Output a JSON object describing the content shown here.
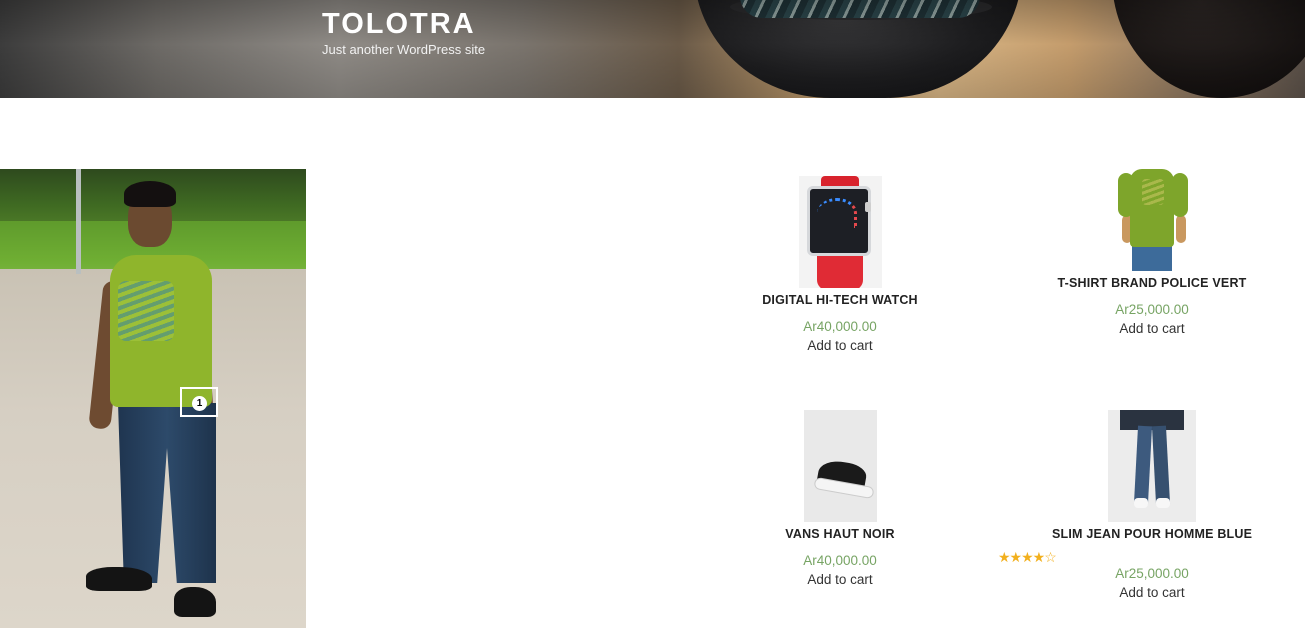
{
  "site": {
    "title": "TOLOTRA",
    "description": "Just another WordPress site"
  },
  "hotspot": {
    "badge": "1"
  },
  "products": [
    {
      "title": "DIGITAL HI-TECH WATCH",
      "price": "Ar40,000.00",
      "cart_label": "Add to cart"
    },
    {
      "title": "T-SHIRT BRAND POLICE VERT",
      "price": "Ar25,000.00",
      "cart_label": "Add to cart"
    },
    {
      "title": "VANS HAUT NOIR",
      "price": "Ar40,000.00",
      "cart_label": "Add to cart"
    },
    {
      "title": "SLIM JEAN POUR HOMME BLUE",
      "price": "Ar25,000.00",
      "cart_label": "Add to cart",
      "rating": 4,
      "rating_max": 5,
      "stars_full": "★★★★",
      "stars_empty": "☆"
    }
  ],
  "colors": {
    "price": "#77a464",
    "star": "#f2b01e",
    "title": "#222222"
  }
}
